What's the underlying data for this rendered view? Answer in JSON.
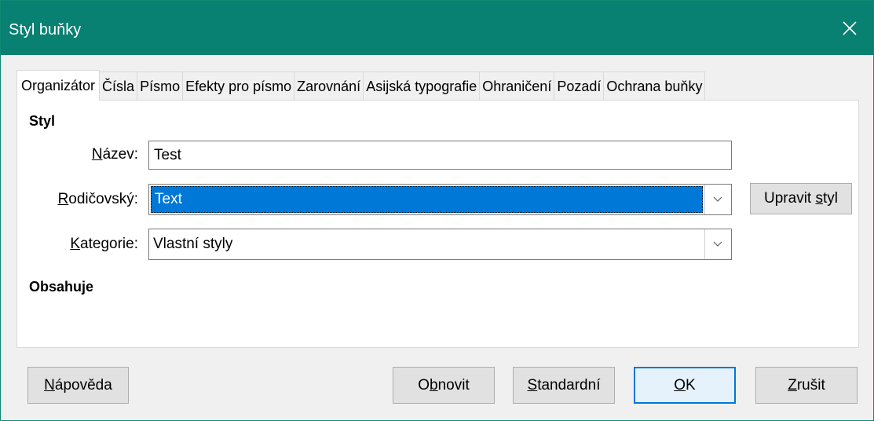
{
  "window": {
    "title": "Styl buňky"
  },
  "tabs": [
    {
      "label": "Organizátor",
      "active": true
    },
    {
      "label": "Čísla"
    },
    {
      "label": "Písmo"
    },
    {
      "label": "Efekty pro písmo"
    },
    {
      "label": "Zarovnání"
    },
    {
      "label": "Asijská typografie"
    },
    {
      "label": "Ohraničení"
    },
    {
      "label": "Pozadí"
    },
    {
      "label": "Ochrana buňky"
    }
  ],
  "style_section": {
    "heading": "Styl",
    "name": {
      "label_ul": "N",
      "label_rest": "ázev:",
      "value": "Test"
    },
    "parent": {
      "label_ul": "R",
      "label_rest": "odičovský:",
      "value": "Text"
    },
    "category": {
      "label_ul": "K",
      "label_rest": "ategorie:",
      "value": "Vlastní styly"
    },
    "edit_style_button": {
      "label_pre": "Upravit ",
      "label_ul": "s",
      "label_rest": "tyl"
    }
  },
  "contains_section": {
    "heading": "Obsahuje"
  },
  "footer": {
    "help": {
      "label_ul": "N",
      "label_rest": "ápověda"
    },
    "reset": {
      "label_pre": "O",
      "label_ul": "b",
      "label_rest": "novit"
    },
    "standard": {
      "label_ul": "S",
      "label_rest": "tandardní"
    },
    "ok": {
      "label_ul": "O",
      "label_rest": "K"
    },
    "cancel": {
      "label_ul": "Z",
      "label_rest": "rušit"
    }
  },
  "icons": {
    "close": "close-icon",
    "dropdown": "chevron-down-icon"
  },
  "colors": {
    "titlebar": "#088072",
    "selection": "#0078d7",
    "default_button_border": "#0078d7"
  }
}
